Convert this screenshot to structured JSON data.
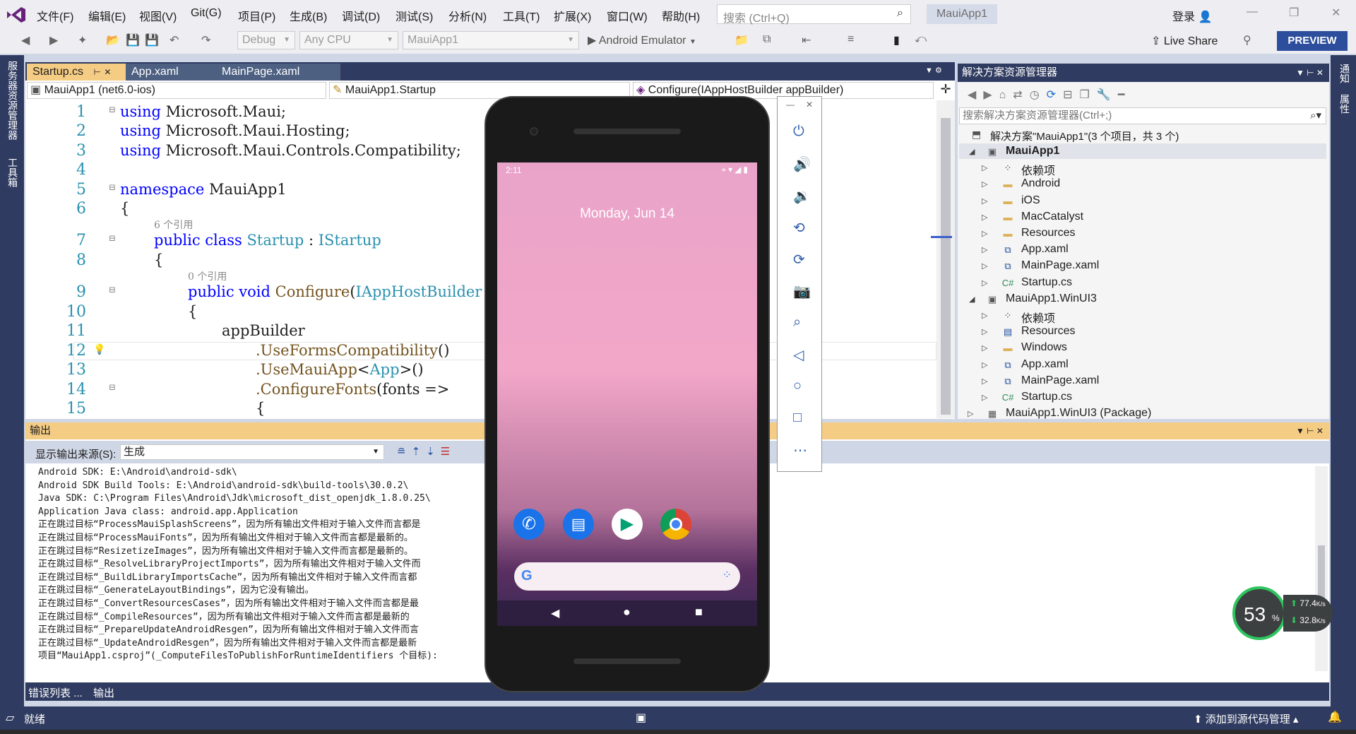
{
  "menu": {
    "items": [
      "文件(F)",
      "编辑(E)",
      "视图(V)",
      "Git(G)",
      "项目(P)",
      "生成(B)",
      "调试(D)",
      "测试(S)",
      "分析(N)",
      "工具(T)",
      "扩展(X)",
      "窗口(W)",
      "帮助(H)"
    ],
    "search_placeholder": "搜索 (Ctrl+Q)",
    "app_title": "MauiApp1",
    "login": "登录"
  },
  "toolbar": {
    "config": "Debug",
    "platform": "Any CPU",
    "startup_project": "MauiApp1",
    "run_target": "Android Emulator",
    "live_share": "Live Share",
    "preview": "PREVIEW"
  },
  "left_rail": {
    "server_explorer": "服务器资源管理器",
    "toolbox": "工具箱"
  },
  "right_rail": {
    "notifications": "通知",
    "properties": "属性"
  },
  "editor": {
    "tabs": [
      "Startup.cs",
      "App.xaml",
      "MainPage.xaml"
    ],
    "nav_project": "MauiApp1 (net6.0-ios)",
    "nav_class": "MauiApp1.Startup",
    "nav_member": "Configure(IAppHostBuilder appBuilder)",
    "line_numbers": [
      "1",
      "2",
      "3",
      "4",
      "5",
      "6",
      "7",
      "8",
      "9",
      "10",
      "11",
      "12",
      "13",
      "14",
      "15"
    ],
    "ref6": "6 个引用",
    "ref0": "0 个引用",
    "code": {
      "l1_kw": "using",
      "l1": " Microsoft.Maui;",
      "l2_kw": "using",
      "l2": " Microsoft.Maui.Hosting;",
      "l3_kw": "using",
      "l3": " Microsoft.Maui.Controls.Compatibility;",
      "l5_kw": "namespace",
      "l5": " MauiApp1",
      "l6": "{",
      "l7_kw": "public class",
      "l7_ty": "Startup",
      "l7_sep": " : ",
      "l7_ty2": "IStartup",
      "l8": "{",
      "l9_kw": "public void",
      "l9_fn": "Configure",
      "l9_ty": "IAppHostBuilder",
      "l10": "{",
      "l11": "appBuilder",
      "l12_fn": ".UseFormsCompatibility",
      "l12_p": "()",
      "l13_fn": ".UseMauiApp",
      "l13_ty": "App",
      "l13_p": "()",
      "l14_fn": ".ConfigureFonts",
      "l14_p": "(fonts =>",
      "l15": "{"
    }
  },
  "solution": {
    "title": "解决方案资源管理器",
    "search_placeholder": "搜索解决方案资源管理器(Ctrl+;)",
    "root": "解决方案\"MauiApp1\"(3 个项目，共 3 个)",
    "items": [
      {
        "label": "MauiApp1",
        "bold": true
      },
      {
        "label": "依赖项"
      },
      {
        "label": "Android"
      },
      {
        "label": "iOS"
      },
      {
        "label": "MacCatalyst"
      },
      {
        "label": "Resources"
      },
      {
        "label": "App.xaml"
      },
      {
        "label": "MainPage.xaml"
      },
      {
        "label": "Startup.cs"
      },
      {
        "label": "MauiApp1.WinUI3"
      },
      {
        "label": "依赖项"
      },
      {
        "label": "Resources"
      },
      {
        "label": "Windows"
      },
      {
        "label": "App.xaml"
      },
      {
        "label": "MainPage.xaml"
      },
      {
        "label": "Startup.cs"
      },
      {
        "label": "MauiApp1.WinUI3 (Package)"
      }
    ]
  },
  "output": {
    "title": "输出",
    "source_label": "显示输出来源(S):",
    "source_value": "生成",
    "lines": [
      "Android SDK: E:\\Android\\android-sdk\\",
      "Android SDK Build Tools: E:\\Android\\android-sdk\\build-tools\\30.0.2\\",
      "Java SDK: C:\\Program Files\\Android\\Jdk\\microsoft_dist_openjdk_1.8.0.25\\",
      "Application Java class: android.app.Application",
      "正在跳过目标“ProcessMauiSplashScreens”，因为所有输出文件相对于输入文件而言都是",
      "正在跳过目标“ProcessMauiFonts”，因为所有输出文件相对于输入文件而言都是最新的。",
      "正在跳过目标“ResizetizeImages”，因为所有输出文件相对于输入文件而言都是最新的。",
      "正在跳过目标“_ResolveLibraryProjectImports”，因为所有输出文件相对于输入文件而",
      "正在跳过目标“_BuildLibraryImportsCache”，因为所有输出文件相对于输入文件而言都",
      "正在跳过目标“_GenerateLayoutBindings”，因为它没有输出。",
      "正在跳过目标“_ConvertResourcesCases”，因为所有输出文件相对于输入文件而言都是最",
      "正在跳过目标“_CompileResources”，因为所有输出文件相对于输入文件而言都是最新的",
      "正在跳过目标“_PrepareUpdateAndroidResgen”，因为所有输出文件相对于输入文件而言",
      "正在跳过目标“_UpdateAndroidResgen”，因为所有输出文件相对于输入文件而言都是最新",
      "项目“MauiApp1.csproj”(_ComputeFilesToPublishForRuntimeIdentifiers 个目标):"
    ]
  },
  "bottom_tabs": [
    "错误列表 ...",
    "输出"
  ],
  "status": {
    "ready": "就绪",
    "add_source_control": "添加到源代码管理"
  },
  "emulator": {
    "time": "2:11",
    "date": "Monday, Jun 14"
  },
  "netmon": {
    "percent": "53",
    "unit": "%",
    "up": "77.4",
    "down": "32.8",
    "rate_unit": "K/s"
  },
  "colors": {
    "accent": "#2f3b60",
    "active_tab": "#f5cc84",
    "preview": "#2d4e9c"
  }
}
